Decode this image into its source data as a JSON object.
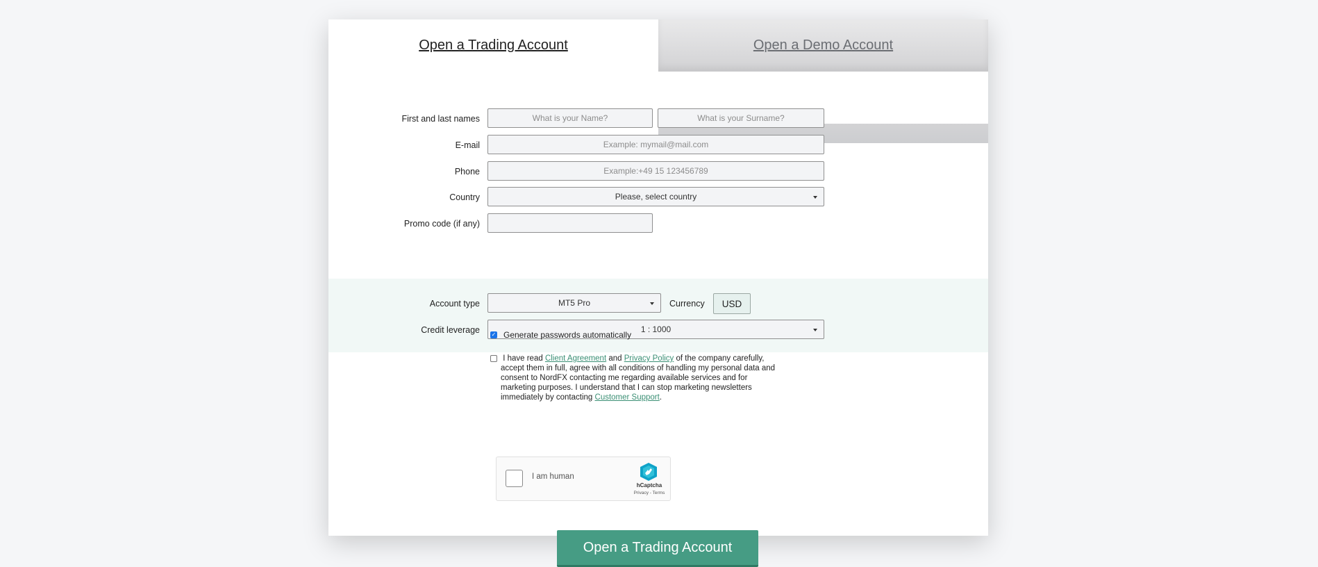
{
  "tabs": {
    "trading": "Open a Trading Account",
    "demo": "Open a Demo Account"
  },
  "form": {
    "names_label": "First and last names",
    "name_placeholder": "What is your Name?",
    "surname_placeholder": "What is your Surname?",
    "email_label": "E-mail",
    "email_placeholder": "Example: mymail@mail.com",
    "phone_label": "Phone",
    "phone_placeholder": "Example:+49 15 123456789",
    "country_label": "Country",
    "country_value": "Please, select country",
    "promo_label": "Promo code (if any)",
    "promo_value": ""
  },
  "account": {
    "type_label": "Account type",
    "type_value": "MT5 Pro",
    "currency_label": "Currency",
    "currency_value": "USD",
    "leverage_label": "Credit leverage",
    "leverage_value": "1 : 1000"
  },
  "options": {
    "generate_passwords": "Generate passwords automatically",
    "generate_checked": true,
    "agree_checked": false,
    "agree_part1": "I have read ",
    "client_agreement": "Client Agreement",
    "agree_part2": " and ",
    "privacy_policy": "Privacy Policy",
    "agree_part3": " of the company carefully, accept them in full, agree with all conditions of handling my personal data and consent to NordFX contacting me regarding available services and for marketing purposes. I understand that I can stop marketing newsletters immediately by contacting ",
    "customer_support": "Customer Support",
    "agree_part4": "."
  },
  "captcha": {
    "label": "I am human",
    "brand": "hCaptcha",
    "links": "Privacy - Terms"
  },
  "submit_label": "Open a Trading Account",
  "colors": {
    "accent": "#469c84",
    "link": "#3a8f74",
    "band": "#f1f8f6"
  }
}
